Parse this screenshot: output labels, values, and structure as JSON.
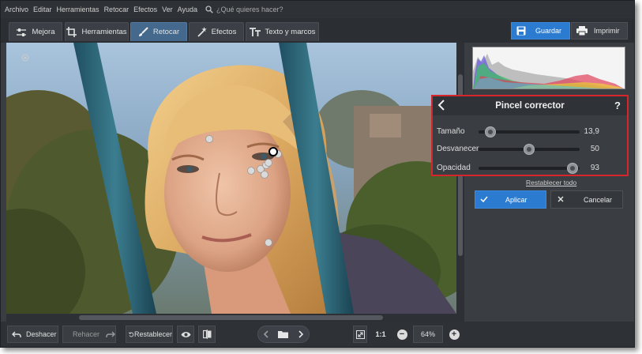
{
  "menu": {
    "items": [
      "Archivo",
      "Editar",
      "Herramientas",
      "Retocar",
      "Efectos",
      "Ver",
      "Ayuda"
    ],
    "search_placeholder": "¿Qué quieres hacer?"
  },
  "tabs": [
    {
      "label": "Mejora",
      "icon": "sliders-icon",
      "active": false
    },
    {
      "label": "Herramientas",
      "icon": "crop-icon",
      "active": false
    },
    {
      "label": "Retocar",
      "icon": "brush-icon",
      "active": true
    },
    {
      "label": "Efectos",
      "icon": "magic-wand-icon",
      "active": false
    },
    {
      "label": "Texto y marcos",
      "icon": "text-icon",
      "active": false
    }
  ],
  "actions": {
    "save_label": "Guardar",
    "print_label": "Imprimir"
  },
  "tool_panel": {
    "title": "Pincel corrector",
    "help": "?",
    "sliders": [
      {
        "label": "Tamaño",
        "value": "13,9",
        "fraction": 0.12
      },
      {
        "label": "Desvanecer",
        "value": "50",
        "fraction": 0.5
      },
      {
        "label": "Opacidad",
        "value": "93",
        "fraction": 0.93
      }
    ],
    "reset_all": "Restablecer todo",
    "apply_label": "Aplicar",
    "cancel_label": "Cancelar"
  },
  "bottom": {
    "undo_label": "Deshacer",
    "redo_label": "Rehacer",
    "restore_label": "Restablecer",
    "zoom_one_to_one": "1:1",
    "zoom_level": "64%"
  },
  "colors": {
    "accent": "#2b7bd0",
    "active_tab": "#45698c",
    "highlight_border": "#d6262c",
    "background": "#3a3d42"
  }
}
